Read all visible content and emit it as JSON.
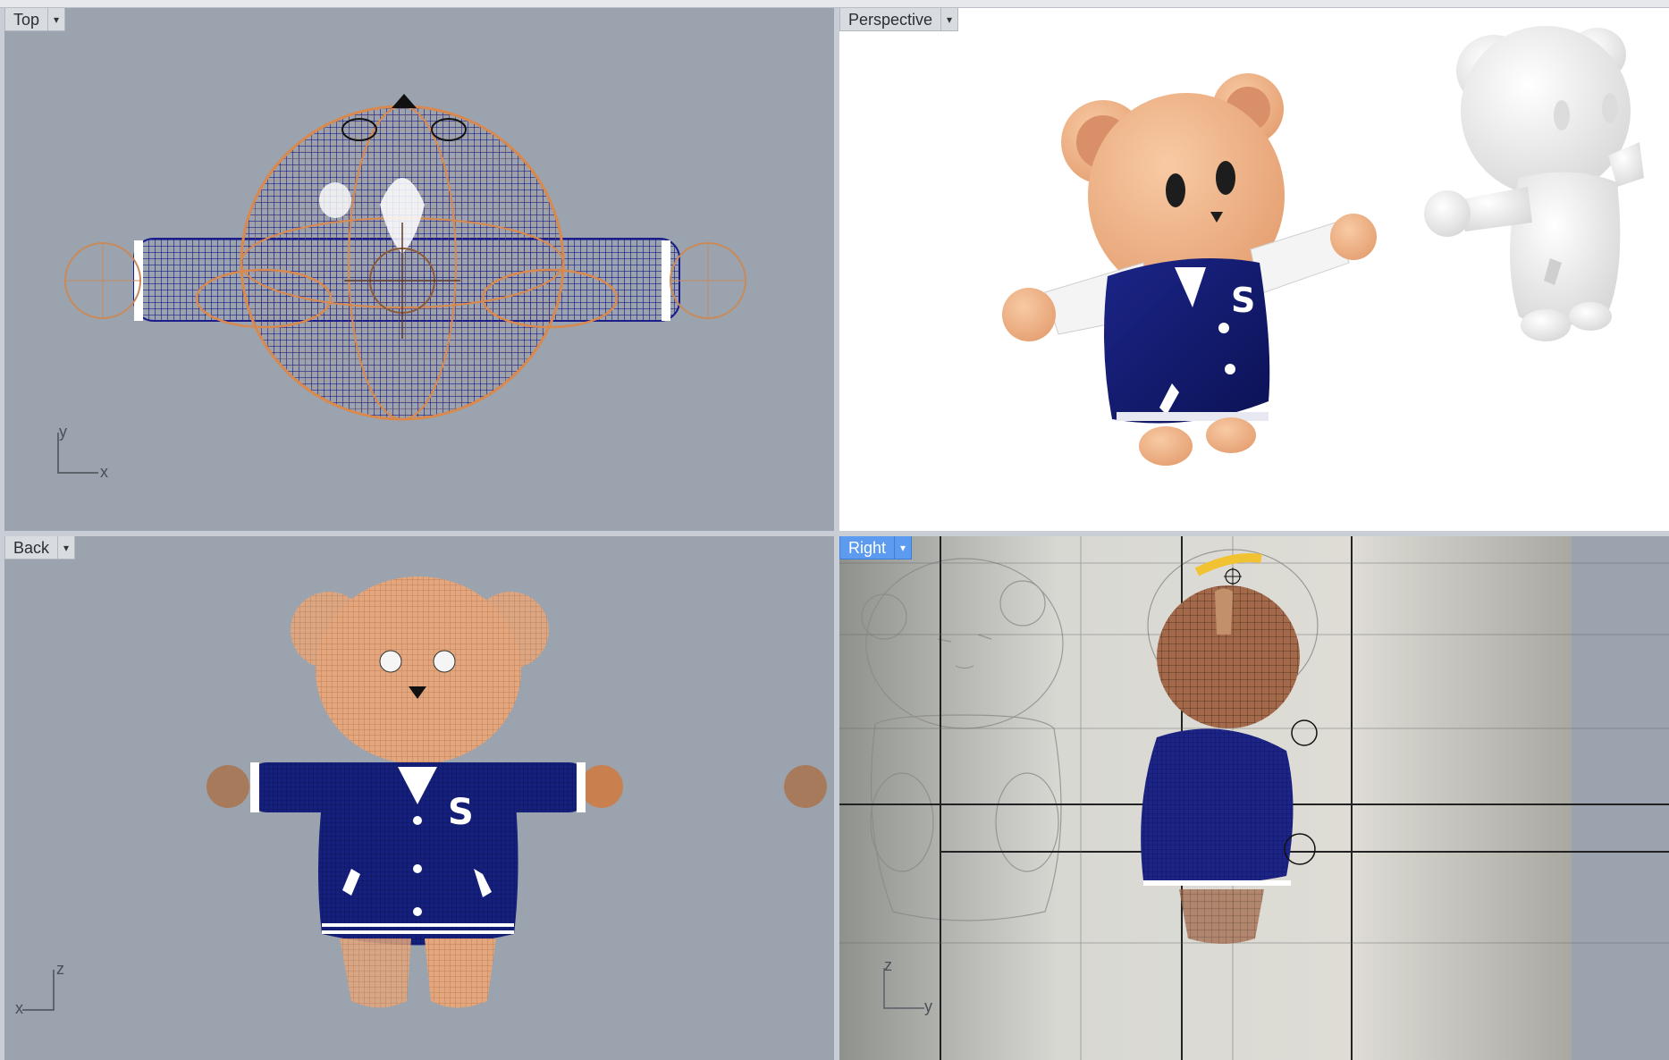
{
  "viewports": {
    "top": {
      "label": "Top",
      "axis_h": "x",
      "axis_v": "y"
    },
    "perspective": {
      "label": "Perspective"
    },
    "back": {
      "label": "Back",
      "axis_h": "x",
      "axis_v": "z"
    },
    "right": {
      "label": "Right",
      "axis_h": "y",
      "axis_v": "z",
      "active": true
    }
  },
  "icons": {
    "dropdown": "triangle-down-icon"
  },
  "colors": {
    "wire_blue": "#1a1d8a",
    "wire_orange": "#d9894e",
    "fur": "#f2b98e",
    "jacket": "#12196b",
    "active_tab": "#5c9bef"
  },
  "jacket_letter": "S"
}
